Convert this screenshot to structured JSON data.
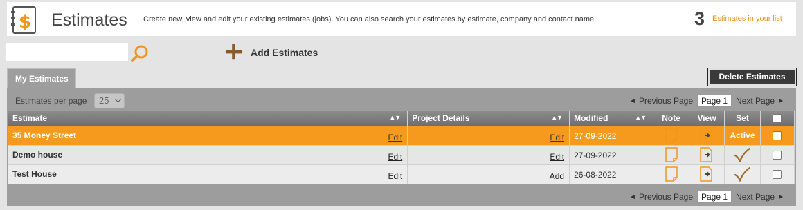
{
  "header": {
    "title": "Estimates",
    "description": "Create new, view and edit your existing estimates (jobs). You can also search your estimates by estimate, company and contact name.",
    "count": "3",
    "count_label": "Estimates in your list"
  },
  "toolbar": {
    "search_value": "",
    "add_label": "Add Estimates"
  },
  "tabs": {
    "active_tab": "My Estimates",
    "delete_label": "Delete Estimates"
  },
  "pagination": {
    "per_page_label": "Estimates per page",
    "per_page_value": "25",
    "previous_label": "Previous Page",
    "current_page": "Page 1",
    "next_label": "Next Page"
  },
  "table": {
    "headers": {
      "estimate": "Estimate",
      "project": "Project Details",
      "modified": "Modified",
      "note": "Note",
      "view": "View",
      "set": "Set"
    },
    "rows": [
      {
        "name": "35 Money Street",
        "edit": "Edit",
        "project_action": "Edit",
        "modified": "27-09-2022",
        "set": "Active"
      },
      {
        "name": "Demo house",
        "edit": "Edit",
        "project_action": "Edit",
        "modified": "27-09-2022",
        "set": ""
      },
      {
        "name": "Test House",
        "edit": "Edit",
        "project_action": "Add",
        "modified": "26-08-2022",
        "set": ""
      }
    ]
  },
  "colors": {
    "accent": "#f59a1c",
    "header_gray": "#7a7a7a",
    "panel_gray": "#9d9d9d"
  },
  "icons": [
    "dollar-document-icon",
    "search-icon",
    "plus-icon",
    "sort-icon",
    "note-icon",
    "view-icon",
    "checkmark-icon",
    "checkbox"
  ]
}
